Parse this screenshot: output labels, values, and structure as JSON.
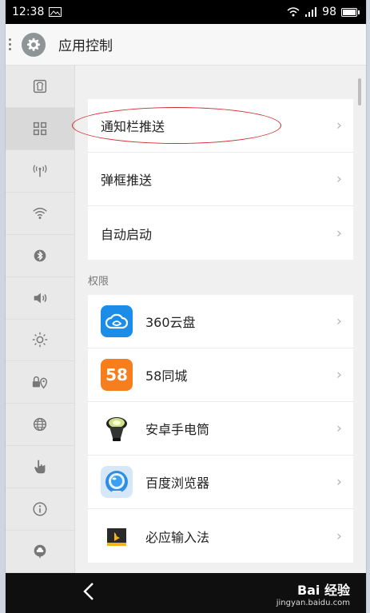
{
  "status_bar": {
    "time": "12:38",
    "battery": "98"
  },
  "header": {
    "title": "应用控制"
  },
  "sidebar": {
    "items": [
      {
        "icon": "shirt-icon"
      },
      {
        "icon": "grid-icon",
        "active": true
      },
      {
        "icon": "antenna-icon"
      },
      {
        "icon": "wifi-icon"
      },
      {
        "icon": "bluetooth-icon"
      },
      {
        "icon": "speaker-icon"
      },
      {
        "icon": "brightness-icon"
      },
      {
        "icon": "lock-location-icon"
      },
      {
        "icon": "globe-icon"
      },
      {
        "icon": "hand-pointer-icon"
      },
      {
        "icon": "info-icon"
      },
      {
        "icon": "cloud-icon"
      }
    ]
  },
  "settings": [
    {
      "label": "通知栏推送"
    },
    {
      "label": "弹框推送"
    },
    {
      "label": "自动启动"
    }
  ],
  "permissions": {
    "section_label": "权限",
    "apps": [
      {
        "name": "360云盘"
      },
      {
        "name": "58同城",
        "icon_text": "58"
      },
      {
        "name": "安卓手电筒"
      },
      {
        "name": "百度浏览器"
      },
      {
        "name": "必应输入法"
      }
    ]
  },
  "watermark": {
    "brand": "Bai 经验",
    "url": "jingyan.baidu.com"
  },
  "colors": {
    "highlight": "#d2292c",
    "icon_360": "#1b8ce8",
    "icon_58": "#f57f1f"
  }
}
